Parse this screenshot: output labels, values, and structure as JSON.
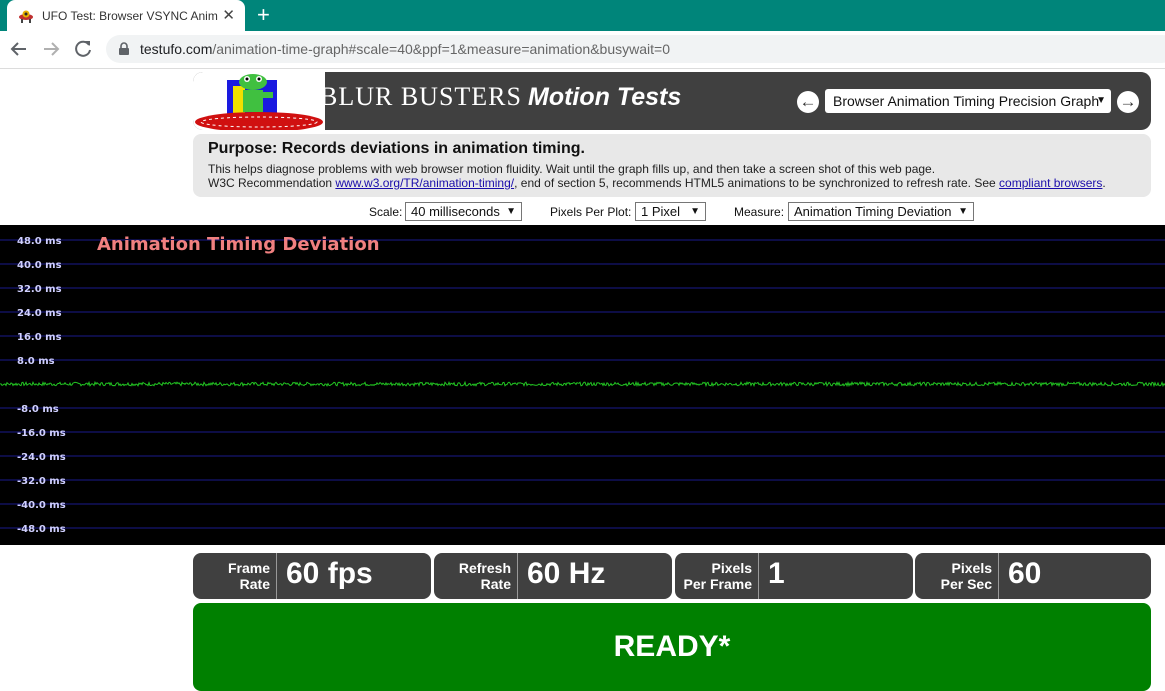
{
  "browser": {
    "tab_title": "UFO Test: Browser VSYNC Animation Timing",
    "tab_close_glyph": "✕",
    "new_tab_glyph": "+",
    "url_host": "testufo.com",
    "url_rest": "/animation-time-graph#scale=40&ppf=1&measure=animation&busywait=0",
    "icons": [
      "back-arrow-icon",
      "forward-arrow-icon",
      "reload-icon",
      "lock-icon",
      "ufo-favicon-icon"
    ]
  },
  "header": {
    "brand_main": "BLUR  BUSTERS",
    "brand_italic": "Motion Tests",
    "prev_glyph": "←",
    "next_glyph": "→",
    "test_select": "Browser Animation Timing Precision Graph"
  },
  "purpose": {
    "heading": "Purpose: Records deviations in animation timing.",
    "line1": "This helps diagnose problems with web browser motion fluidity. Wait until the graph fills up, and then take a screen shot of this web page.",
    "line2_before": "W3C Recommendation ",
    "line2_link1": "www.w3.org/TR/animation-timing/",
    "line2_middle": ", end of section 5, recommends HTML5 animations to be synchronized to refresh rate. See ",
    "line2_link2": "compliant browsers",
    "line2_after": "."
  },
  "settings": {
    "scale_label": "Scale:",
    "scale_value": "40 milliseconds",
    "ppp_label": "Pixels Per Plot:",
    "ppp_value": "1 Pixel",
    "measure_label": "Measure:",
    "measure_value": "Animation Timing Deviation"
  },
  "chart_data": {
    "type": "line",
    "title": "Animation Timing Deviation",
    "ytick_labels": [
      "48.0 ms",
      "40.0 ms",
      "32.0 ms",
      "24.0 ms",
      "16.0 ms",
      "8.0 ms",
      "-8.0 ms",
      "-16.0 ms",
      "-24.0 ms",
      "-32.0 ms",
      "-40.0 ms",
      "-48.0 ms"
    ],
    "ylim": [
      -50,
      50
    ],
    "grid": true,
    "series": [
      {
        "values_ms_range": [
          -0.6,
          0.6
        ],
        "description_level": "near zero deviation across the full width"
      }
    ],
    "colors": {
      "background": "#000000",
      "grid": "#1a1a8c",
      "trace": "#22c522",
      "title": "#f08080",
      "labels": "#d0d0ff"
    }
  },
  "stats": [
    {
      "label_line1": "Frame",
      "label_line2": "Rate",
      "value": "60 fps"
    },
    {
      "label_line1": "Refresh",
      "label_line2": "Rate",
      "value": "60 Hz"
    },
    {
      "label_line1": "Pixels",
      "label_line2": "Per Frame",
      "value": "1"
    },
    {
      "label_line1": "Pixels",
      "label_line2": "Per Sec",
      "value": "60"
    }
  ],
  "status": "READY*"
}
